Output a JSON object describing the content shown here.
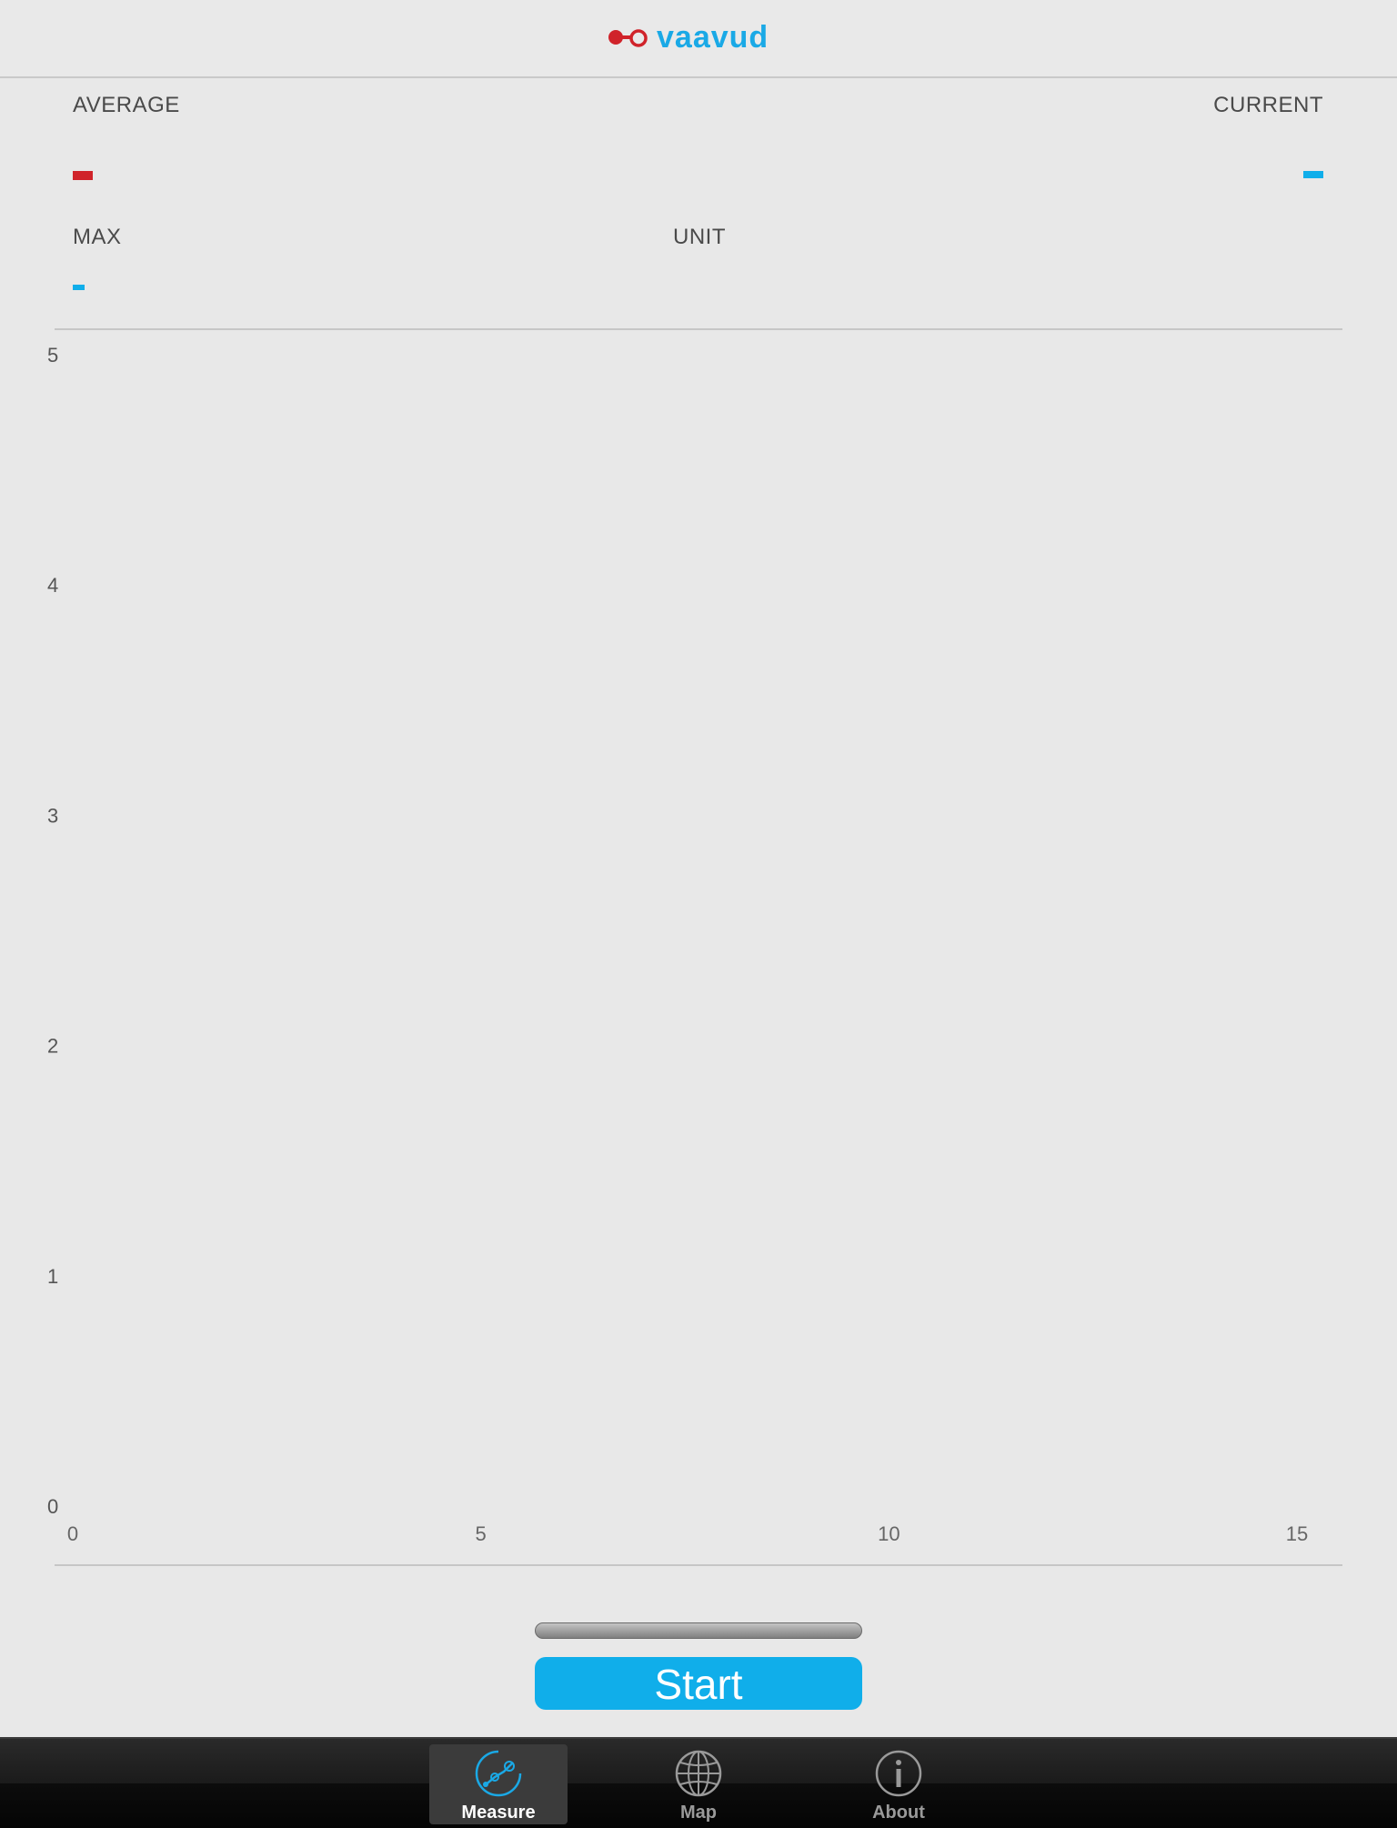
{
  "header": {
    "logo_text": "vaavud"
  },
  "stats": {
    "average_label": "AVERAGE",
    "current_label": "CURRENT",
    "max_label": "MAX",
    "unit_label": "UNIT",
    "average_value": "",
    "current_value": "",
    "max_value": "",
    "unit_value": ""
  },
  "colors": {
    "red": "#d0232a",
    "blue": "#10aeea"
  },
  "chart_data": {
    "type": "line",
    "x_ticks": [
      "0",
      "5",
      "10",
      "15"
    ],
    "y_ticks": [
      "0",
      "1",
      "2",
      "3",
      "4",
      "5"
    ],
    "xlim": [
      0,
      15
    ],
    "ylim": [
      0,
      5
    ],
    "series": []
  },
  "controls": {
    "progress": 0,
    "start_label": "Start"
  },
  "tabbar": {
    "items": [
      {
        "label": "Measure",
        "icon": "anemometer-icon",
        "active": true
      },
      {
        "label": "Map",
        "icon": "globe-icon",
        "active": false
      },
      {
        "label": "About",
        "icon": "info-icon",
        "active": false
      }
    ]
  }
}
